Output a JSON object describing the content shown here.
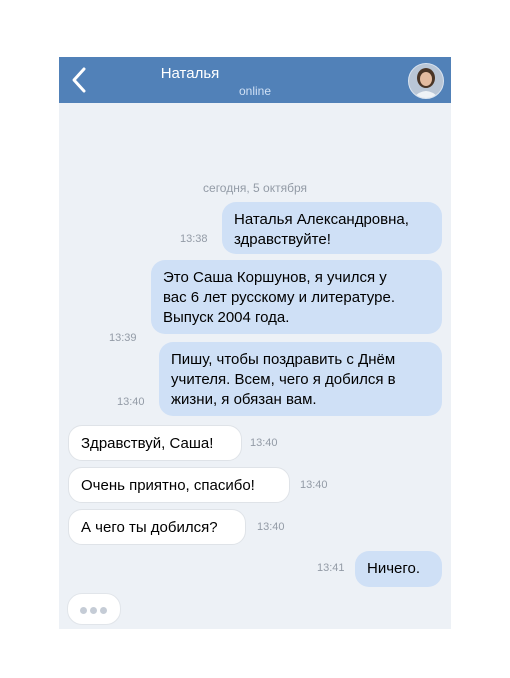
{
  "header": {
    "contact_name": "Наталья",
    "status": "online",
    "back_icon": "chevron-left-icon",
    "avatar_icon": "avatar"
  },
  "chat": {
    "date_separator": "сегодня, 5 октября",
    "messages": [
      {
        "direction": "outgoing",
        "lines": [
          "Наталья Александровна,",
          "здравствуйте!"
        ],
        "time": "13:38"
      },
      {
        "direction": "outgoing",
        "lines": [
          "Это Саша Коршунов, я учился у",
          "вас 6 лет русскому и литературе.",
          "Выпуск 2004 года."
        ],
        "time": "13:39"
      },
      {
        "direction": "outgoing",
        "lines": [
          "Пишу, чтобы поздравить с Днём",
          "учителя. Всем, чего я добился в",
          "жизни, я обязан вам."
        ],
        "time": "13:40"
      },
      {
        "direction": "incoming",
        "lines": [
          "Здравствуй, Саша!"
        ],
        "time": "13:40"
      },
      {
        "direction": "incoming",
        "lines": [
          "Очень приятно, спасибо!"
        ],
        "time": "13:40"
      },
      {
        "direction": "incoming",
        "lines": [
          "А чего ты добился?"
        ],
        "time": "13:40"
      },
      {
        "direction": "outgoing",
        "lines": [
          "Ничего."
        ],
        "time": "13:41"
      }
    ],
    "typing_indicator": "typing-dots-icon"
  },
  "colors": {
    "header_bg": "#5181b8",
    "chat_bg": "#edf1f6",
    "outgoing_bubble": "#cfe0f6",
    "incoming_bubble": "#ffffff",
    "timestamp": "#939ba6"
  }
}
